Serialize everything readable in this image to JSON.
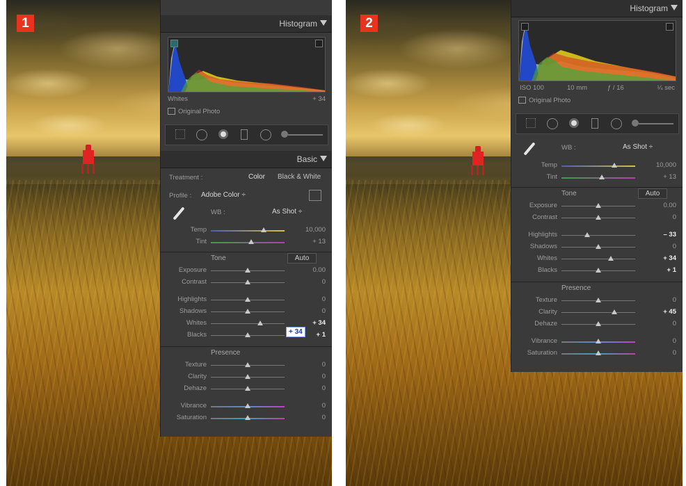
{
  "screens": [
    {
      "badge": "1",
      "histogram_header": "Histogram",
      "histogram_readout": {
        "left": "Whites",
        "right": "+ 34"
      },
      "original_photo": "Original Photo",
      "basic_header": "Basic",
      "treatment": {
        "label": "Treatment :",
        "opt1": "Color",
        "opt2": "Black & White"
      },
      "profile": {
        "label": "Profile :",
        "value": "Adobe Color ÷"
      },
      "wb": {
        "label": "WB :",
        "value": "As Shot ÷"
      },
      "temp": {
        "label": "Temp",
        "value": "10,000",
        "pos": 0.72
      },
      "tint": {
        "label": "Tint",
        "value": "+ 13",
        "pos": 0.55
      },
      "tone": {
        "label": "Tone",
        "auto": "Auto"
      },
      "exposure": {
        "label": "Exposure",
        "value": "0.00",
        "pos": 0.5
      },
      "contrast": {
        "label": "Contrast",
        "value": "0",
        "pos": 0.5
      },
      "highlights": {
        "label": "Highlights",
        "value": "0",
        "pos": 0.5
      },
      "shadows": {
        "label": "Shadows",
        "value": "0",
        "pos": 0.5
      },
      "whites": {
        "label": "Whites",
        "value": "+ 34",
        "pos": 0.67
      },
      "blacks": {
        "label": "Blacks",
        "value": "+ 1",
        "pos": 0.5
      },
      "presence": "Presence",
      "texture": {
        "label": "Texture",
        "value": "0",
        "pos": 0.5
      },
      "clarity": {
        "label": "Clarity",
        "value": "0",
        "pos": 0.5
      },
      "dehaze": {
        "label": "Dehaze",
        "value": "0",
        "pos": 0.5
      },
      "vibrance": {
        "label": "Vibrance",
        "value": "0",
        "pos": 0.5
      },
      "saturation": {
        "label": "Saturation",
        "value": "0",
        "pos": 0.5
      }
    },
    {
      "badge": "2",
      "histogram_header": "Histogram",
      "exif": {
        "iso": "ISO 100",
        "focal": "10 mm",
        "aperture": "ƒ / 16",
        "shutter": "¼ sec"
      },
      "original_photo": "Original Photo",
      "wb": {
        "label": "WB :",
        "value": "As Shot ÷"
      },
      "temp": {
        "label": "Temp",
        "value": "10,000",
        "pos": 0.72
      },
      "tint": {
        "label": "Tint",
        "value": "+ 13",
        "pos": 0.55
      },
      "tone": {
        "label": "Tone",
        "auto": "Auto"
      },
      "exposure": {
        "label": "Exposure",
        "value": "0.00",
        "pos": 0.5
      },
      "contrast": {
        "label": "Contrast",
        "value": "0",
        "pos": 0.5
      },
      "highlights": {
        "label": "Highlights",
        "value": "– 33",
        "pos": 0.35
      },
      "shadows": {
        "label": "Shadows",
        "value": "0",
        "pos": 0.5
      },
      "whites": {
        "label": "Whites",
        "value": "+ 34",
        "pos": 0.67
      },
      "blacks": {
        "label": "Blacks",
        "value": "+ 1",
        "pos": 0.5
      },
      "presence": "Presence",
      "texture": {
        "label": "Texture",
        "value": "0",
        "pos": 0.5
      },
      "clarity": {
        "label": "Clarity",
        "value": "+ 45",
        "pos": 0.72
      },
      "dehaze": {
        "label": "Dehaze",
        "value": "0",
        "pos": 0.5
      },
      "vibrance": {
        "label": "Vibrance",
        "value": "0",
        "pos": 0.5
      },
      "saturation": {
        "label": "Saturation",
        "value": "0",
        "pos": 0.5
      }
    }
  ],
  "colors": {
    "badge": "#e8341f",
    "panel": "#3a3a3a",
    "accent_tag": "#1a3f8f"
  }
}
